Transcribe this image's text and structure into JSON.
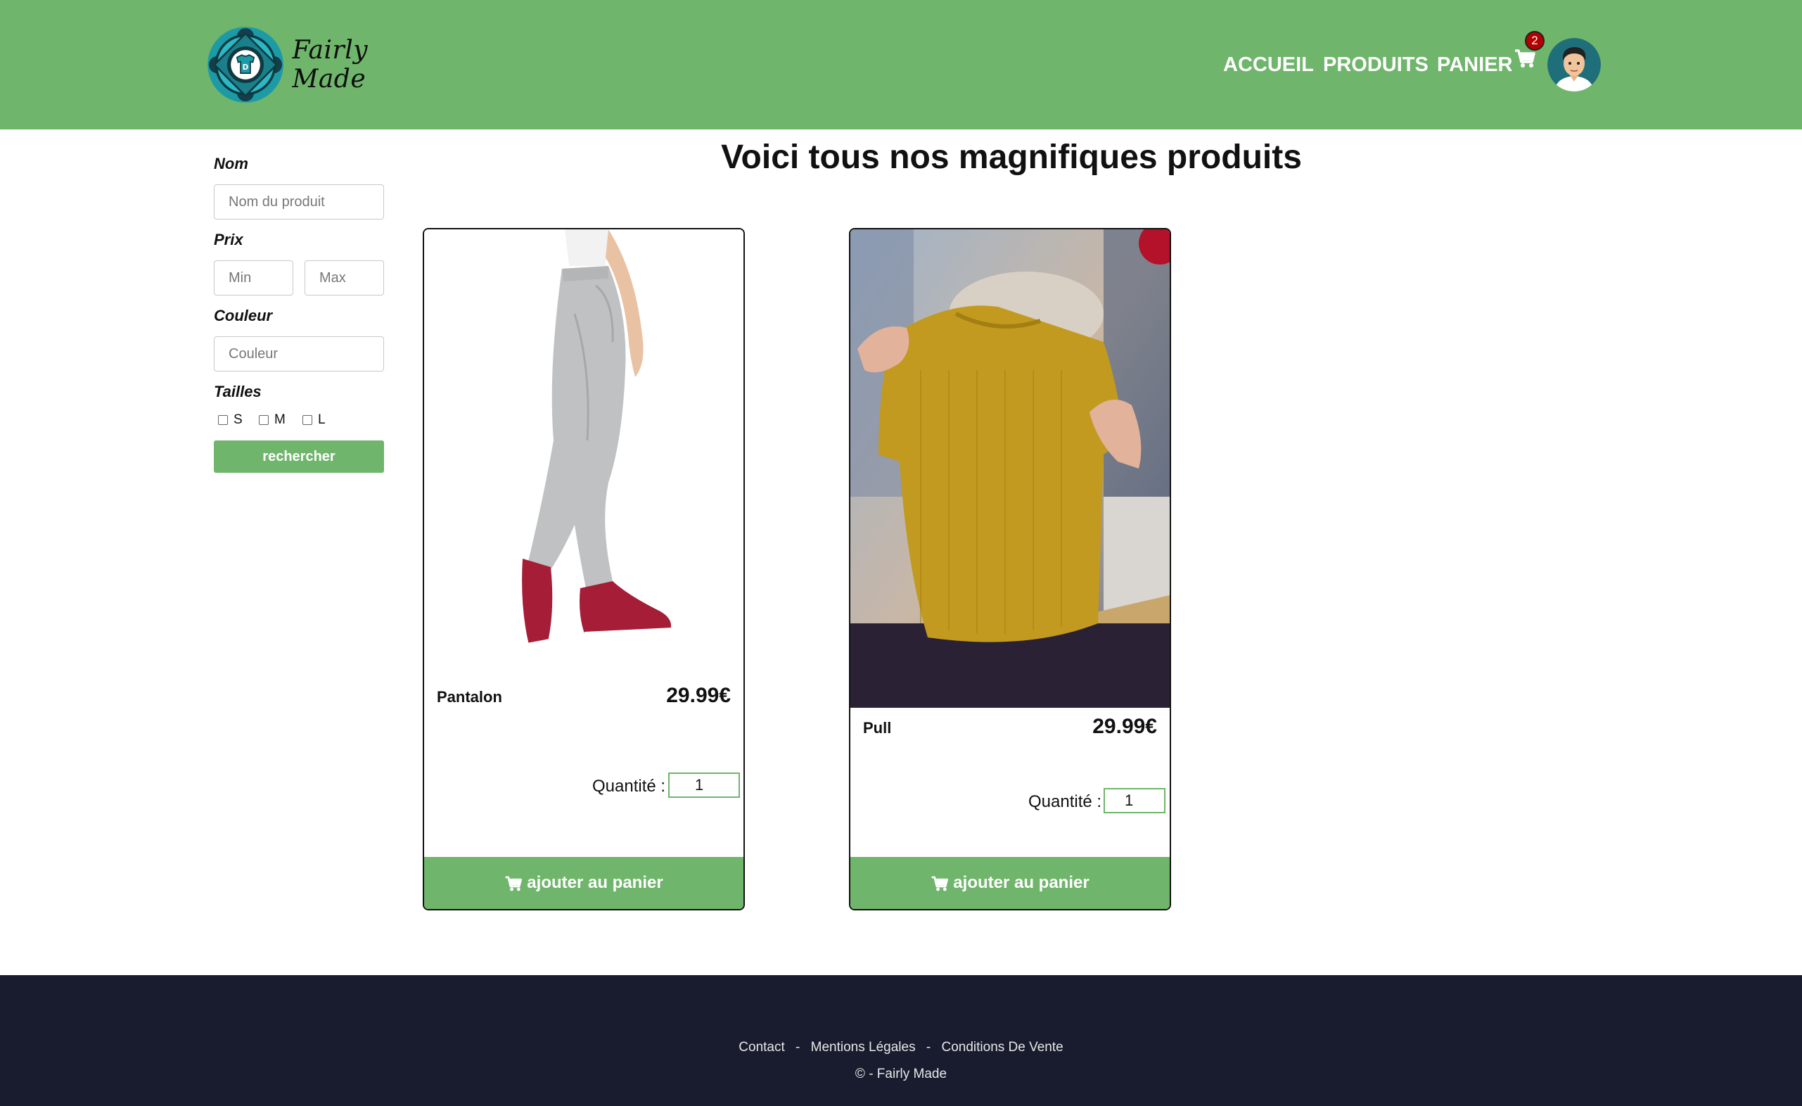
{
  "header": {
    "brand": "Fairly Made",
    "nav": [
      "ACCUEIL",
      "PRODUITS",
      "PANIER"
    ],
    "cart_count": "2",
    "colors": {
      "header_bg": "#6fb56b",
      "badge": "#b30000"
    }
  },
  "filters": {
    "name_label": "Nom",
    "name_placeholder": "Nom du produit",
    "price_label": "Prix",
    "min_placeholder": "Min",
    "max_placeholder": "Max",
    "color_label": "Couleur",
    "color_placeholder": "Couleur",
    "sizes_label": "Tailles",
    "sizes": [
      "S",
      "M",
      "L"
    ],
    "search_label": "rechercher"
  },
  "main": {
    "title": "Voici tous nos magnifiques produits",
    "products": [
      {
        "name": "Pantalon",
        "price": "29.99€",
        "qty_label": "Quantité :",
        "qty": "1",
        "add_label": "ajouter au panier"
      },
      {
        "name": "Pull",
        "price": "29.99€",
        "qty_label": "Quantité :",
        "qty": "1",
        "add_label": "ajouter au panier"
      }
    ]
  },
  "footer": {
    "links": [
      "Contact",
      "Mentions Légales",
      "Conditions De Vente"
    ],
    "separator": "-",
    "copyright": "© - Fairly Made",
    "colors": {
      "footer_bg": "#181c2e"
    }
  }
}
